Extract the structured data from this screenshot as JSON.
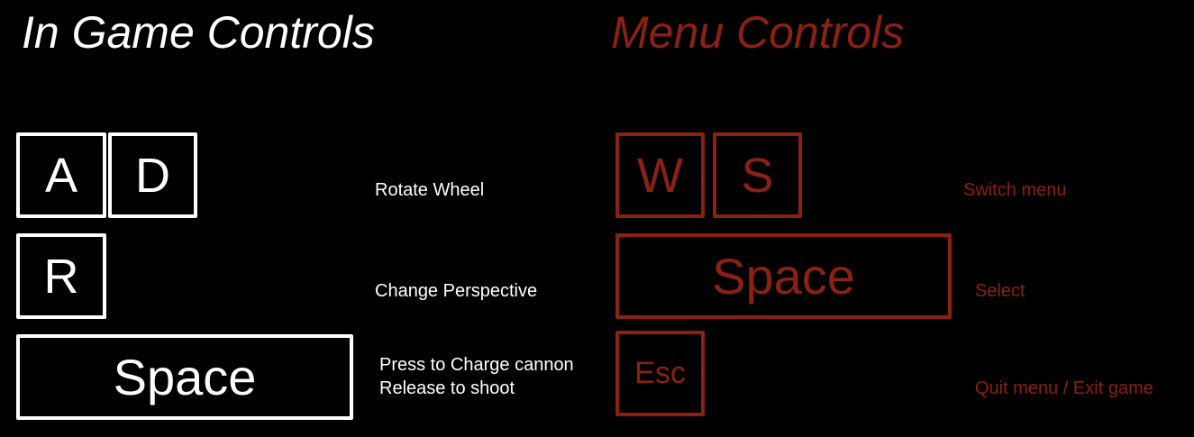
{
  "game_controls": {
    "heading": "In Game Controls",
    "keys": {
      "a": "A",
      "d": "D",
      "r": "R",
      "space": "Space"
    },
    "rotate_wheel": "Rotate Wheel",
    "change_perspective": "Change Perspective",
    "charge_line1": "Press to Charge cannon",
    "charge_line2": "Release to shoot"
  },
  "menu_controls": {
    "heading": "Menu Controls",
    "keys": {
      "w": "W",
      "s": "S",
      "space": "Space",
      "esc": "Esc"
    },
    "switch_menu": "Switch menu",
    "select": "Select",
    "quit": "Quit menu / Exit game"
  },
  "colors": {
    "background": "#000000",
    "game_accent": "#ffffff",
    "menu_accent": "#8a2114"
  }
}
